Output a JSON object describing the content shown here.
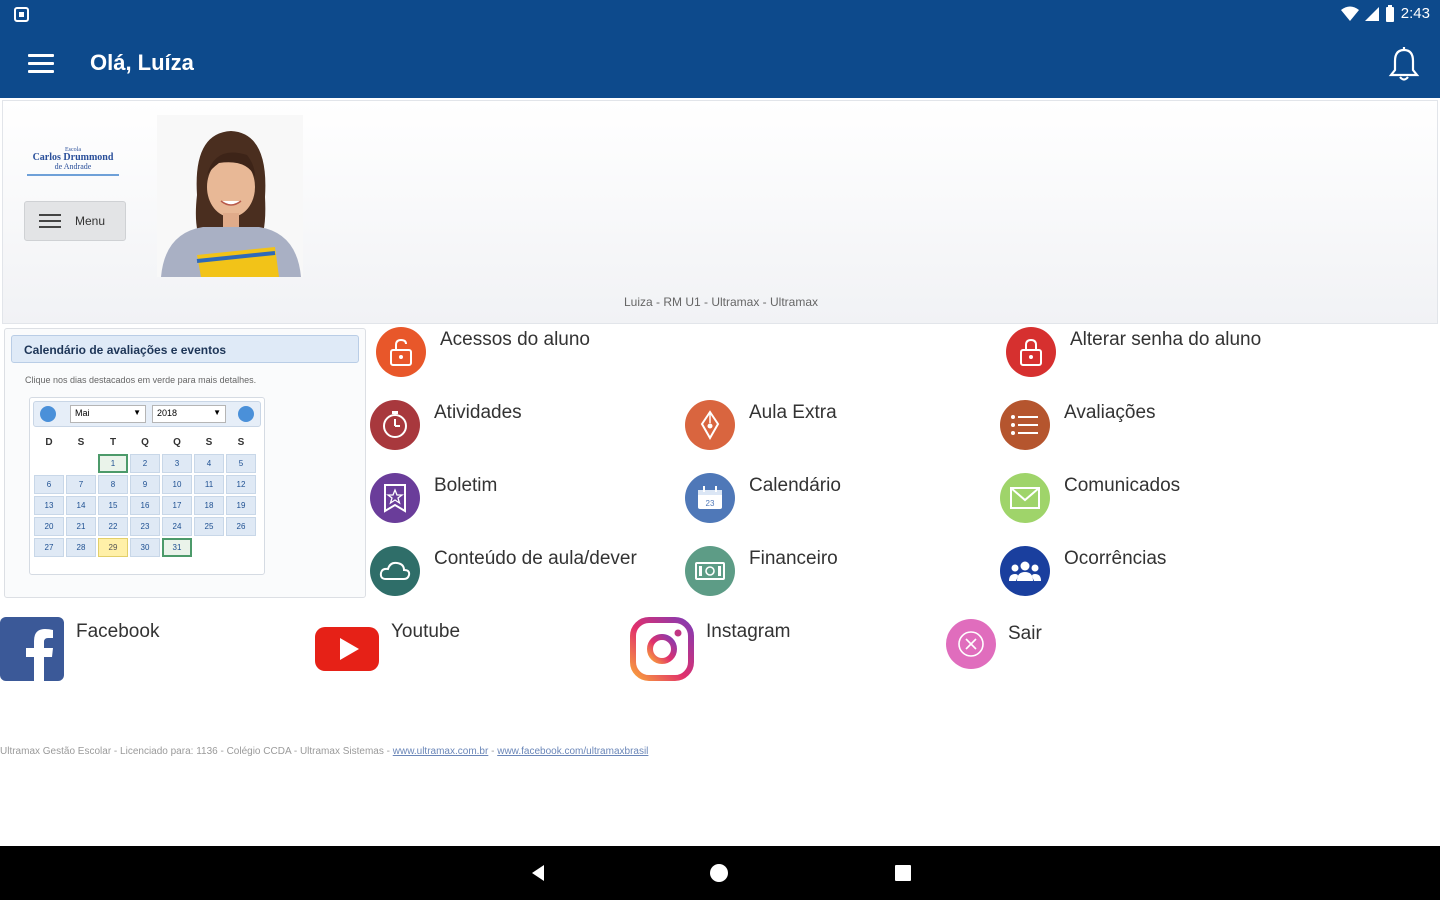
{
  "status_bar": {
    "time": "2:43"
  },
  "app_bar": {
    "title": "Olá, Luíza"
  },
  "profile": {
    "logo": {
      "line1": "Escola",
      "line2": "Carlos Drummond",
      "line3": "de Andrade"
    },
    "menu_label": "Menu",
    "user_line": "Luiza - RM U1 - Ultramax - Ultramax"
  },
  "calendar": {
    "header": "Calendário de avaliações e eventos",
    "hint": "Clique nos dias destacados em verde para mais detalhes.",
    "month": "Mai",
    "year": "2018",
    "weekdays": [
      "D",
      "S",
      "T",
      "Q",
      "Q",
      "S",
      "S"
    ],
    "weeks": [
      [
        "",
        "",
        "1",
        "2",
        "3",
        "4",
        "5"
      ],
      [
        "6",
        "7",
        "8",
        "9",
        "10",
        "11",
        "12"
      ],
      [
        "13",
        "14",
        "15",
        "16",
        "17",
        "18",
        "19"
      ],
      [
        "20",
        "21",
        "22",
        "23",
        "24",
        "25",
        "26"
      ],
      [
        "27",
        "28",
        "29",
        "30",
        "31",
        "",
        ""
      ]
    ],
    "today": "29",
    "highlighted": [
      "1",
      "31"
    ]
  },
  "menu": {
    "acessos": "Acessos do aluno",
    "alterar_senha": "Alterar senha do aluno",
    "atividades": "Atividades",
    "aula_extra": "Aula Extra",
    "avaliacoes": "Avaliações",
    "boletim": "Boletim",
    "calendario": "Calendário",
    "comunicados": "Comunicados",
    "conteudo": "Conteúdo de aula/dever",
    "financeiro": "Financeiro",
    "ocorrencias": "Ocorrências"
  },
  "social": {
    "facebook": "Facebook",
    "youtube": "Youtube",
    "instagram": "Instagram",
    "sair": "Sair"
  },
  "footer": {
    "text": "Ultramax Gestão Escolar - Licenciado para: 1136 - Colégio CCDA - Ultramax Sistemas -",
    "link1": "www.ultramax.com.br",
    "sep": "-",
    "link2": "www.facebook.com/ultramaxbrasil"
  },
  "colors": {
    "primary": "#0d4a8c",
    "acessos": "#e8572a",
    "alterar_senha": "#d6302f",
    "atividades": "#a8383d",
    "aula_extra": "#d9653f",
    "avaliacoes": "#b5552e",
    "boletim": "#6a3d9a",
    "calendario": "#4f78b8",
    "comunicados": "#9fd46a",
    "conteudo": "#2f6e69",
    "financeiro": "#5d9c86",
    "ocorrencias": "#1a3f9e",
    "sair": "#e06dbd"
  },
  "icons": {
    "acessos": "padlock-open-icon",
    "alterar_senha": "padlock-icon",
    "atividades": "stopwatch-icon",
    "aula_extra": "pen-nib-icon",
    "avaliacoes": "list-icon",
    "boletim": "star-document-icon",
    "calendario": "calendar-icon",
    "comunicados": "envelope-icon",
    "conteudo": "cloud-icon",
    "financeiro": "money-icon",
    "ocorrencias": "people-icon"
  }
}
